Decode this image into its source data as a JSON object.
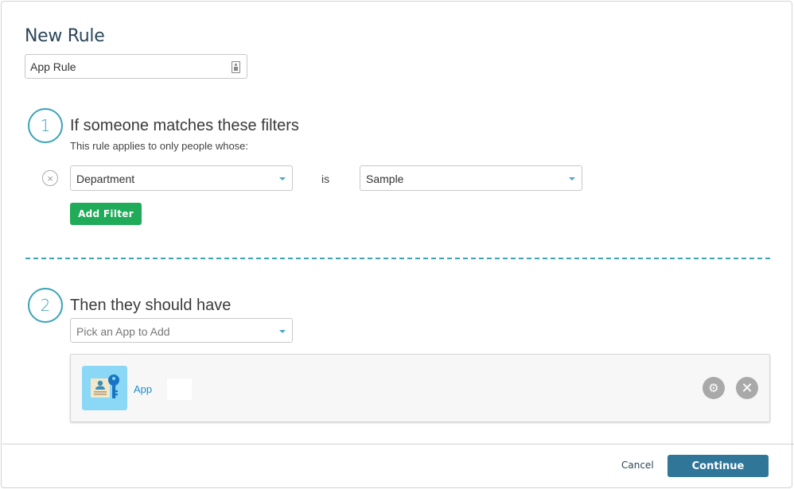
{
  "dialog": {
    "title": "New Rule",
    "rule_name": {
      "value": "App Rule",
      "icon": "contact-card-icon"
    }
  },
  "step1": {
    "number": "1",
    "heading": "If someone matches these filters",
    "subtext": "This rule applies to only people whose:",
    "filters": [
      {
        "remove_icon": "remove-circle-icon",
        "remove_glyph": "×",
        "field": "Department",
        "operator": "is",
        "value": "Sample"
      }
    ],
    "add_filter_label": "Add Filter"
  },
  "step2": {
    "number": "2",
    "heading": "Then they should have",
    "app_picker_placeholder": "Pick an App to Add",
    "apps": [
      {
        "name": "App",
        "icon": "id-card-key-icon",
        "settings_glyph": "⚙",
        "remove_glyph": "✕"
      }
    ]
  },
  "footer": {
    "cancel_label": "Cancel",
    "continue_label": "Continue"
  },
  "colors": {
    "accent": "#3aa3b8",
    "add_filter_green": "#1fab58",
    "continue_blue": "#2f7698",
    "title_text": "#2b4759",
    "app_link": "#1b8dd0"
  }
}
